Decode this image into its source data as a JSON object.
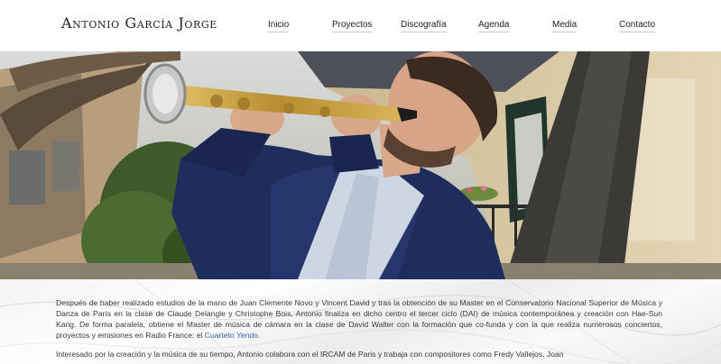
{
  "header": {
    "site_title": "Antonio García Jorge",
    "nav": [
      {
        "label": "Inicio"
      },
      {
        "label": "Proyectos"
      },
      {
        "label": "Discografía"
      },
      {
        "label": "Agenda"
      },
      {
        "label": "Media"
      },
      {
        "label": "Contacto"
      }
    ]
  },
  "content": {
    "paragraph1_text": "Después de haber realizado estudios de la mano de Juan Clemente Novo y Vincent David y tras la obtención de su Master en  el Conservatorio Nacional Superior de Música y Danza de París en la clase de Claude Delangle y Christophe Bois, Antonio finaliza en dicho centro el tercer ciclo (DAI) de música contemporánea y creación con Hae-Sun Kang. De forma paralela, obtiene el Master de música de cámara  en la clase de David Walter con la formación que co-funda y con la que realiza numerosos conciertos, proyectos y emisiones en Radio France: el ",
    "paragraph1_link": "Cuarteto Yendo",
    "paragraph1_end": ".",
    "paragraph2_text": "Interesado por la creación y la música de su tiempo, Antonio colabora con el IRCAM de Paris y trabaja con compositores como Fredy Vallejos, Joan"
  },
  "colors": {
    "link": "#3a5ea8",
    "jacket": "#1f2d5c",
    "saxophone": "#c9a24a"
  }
}
